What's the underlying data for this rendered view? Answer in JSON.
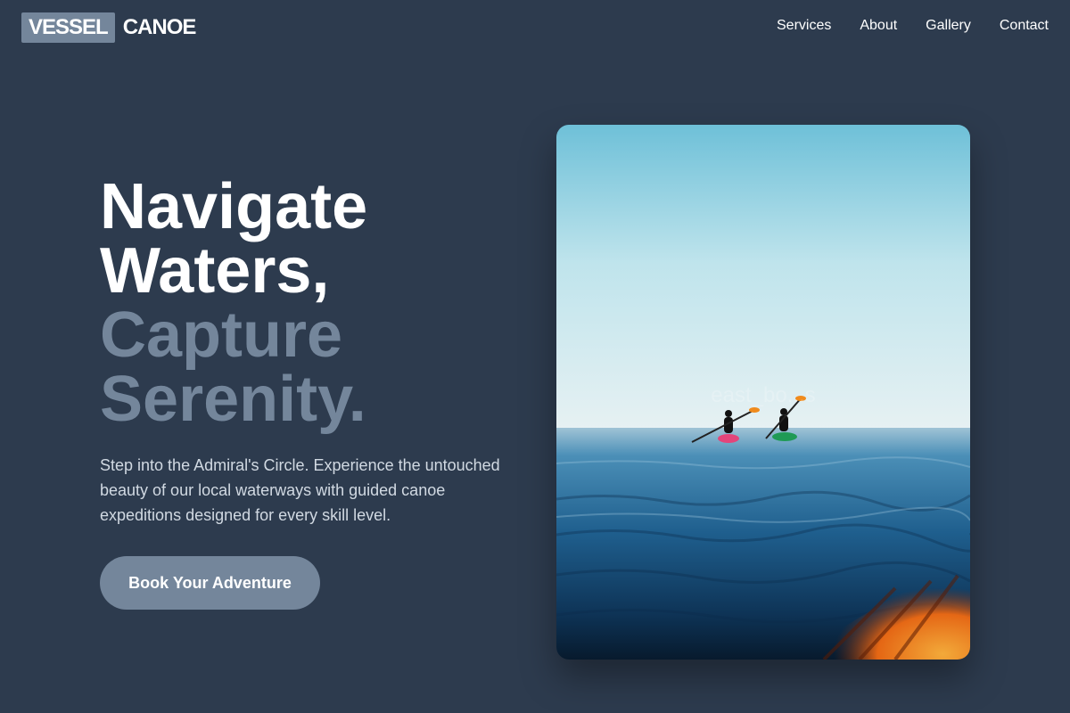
{
  "header": {
    "brand_box": "VESSEL",
    "brand_word": "CANOE",
    "nav": [
      "Services",
      "About",
      "Gallery",
      "Contact"
    ]
  },
  "hero": {
    "headline": [
      "Navigate",
      "Waters,",
      "Capture",
      "Serenity."
    ],
    "intro": "Step into the Admiral's Circle. Experience the untouched beauty of our local waterways with guided canoe expeditions designed for every skill level.",
    "cta": "Book Your Adventure"
  },
  "photo": {
    "watermark": "east_bo...s"
  },
  "colors": {
    "background": "#2d3b4e",
    "accent": "#74869b",
    "text": "#ffffff",
    "body_text": "#d1d9e2"
  }
}
